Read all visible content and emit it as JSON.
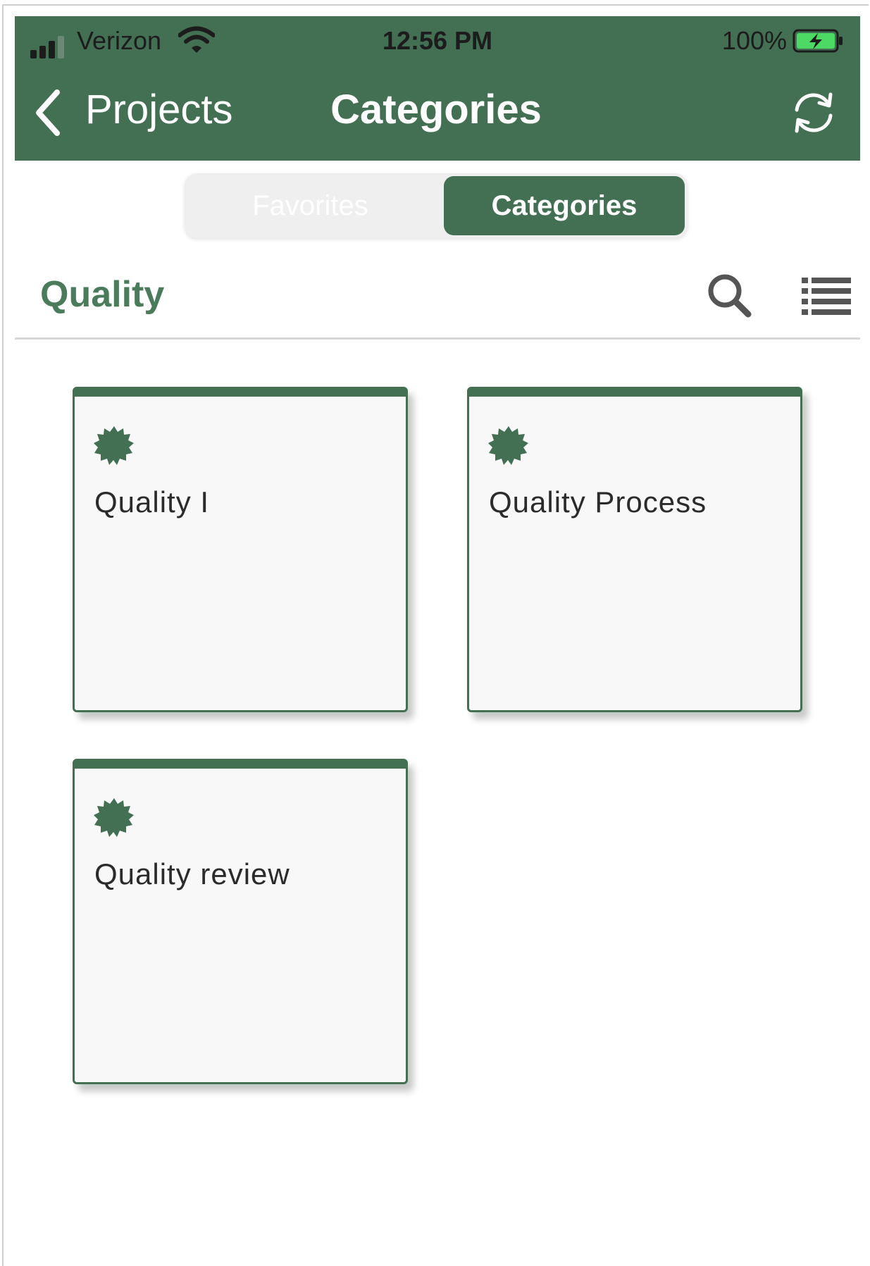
{
  "status_bar": {
    "carrier": "Verizon",
    "time": "12:56 PM",
    "battery": "100%"
  },
  "nav": {
    "back_label": "Projects",
    "title": "Categories"
  },
  "segmented": {
    "items": [
      {
        "label": "Favorites",
        "selected": false
      },
      {
        "label": "Categories",
        "selected": true
      }
    ]
  },
  "section": {
    "title": "Quality"
  },
  "cards": [
    {
      "title": "Quality I",
      "icon": "badge-icon"
    },
    {
      "title": "Quality Process",
      "icon": "badge-icon"
    },
    {
      "title": "Quality review",
      "icon": "badge-icon"
    }
  ],
  "colors": {
    "brand": "#436f53",
    "section_title": "#4a7c5b",
    "card_bg": "#f8f8f8",
    "battery_fill": "#4cd964"
  }
}
